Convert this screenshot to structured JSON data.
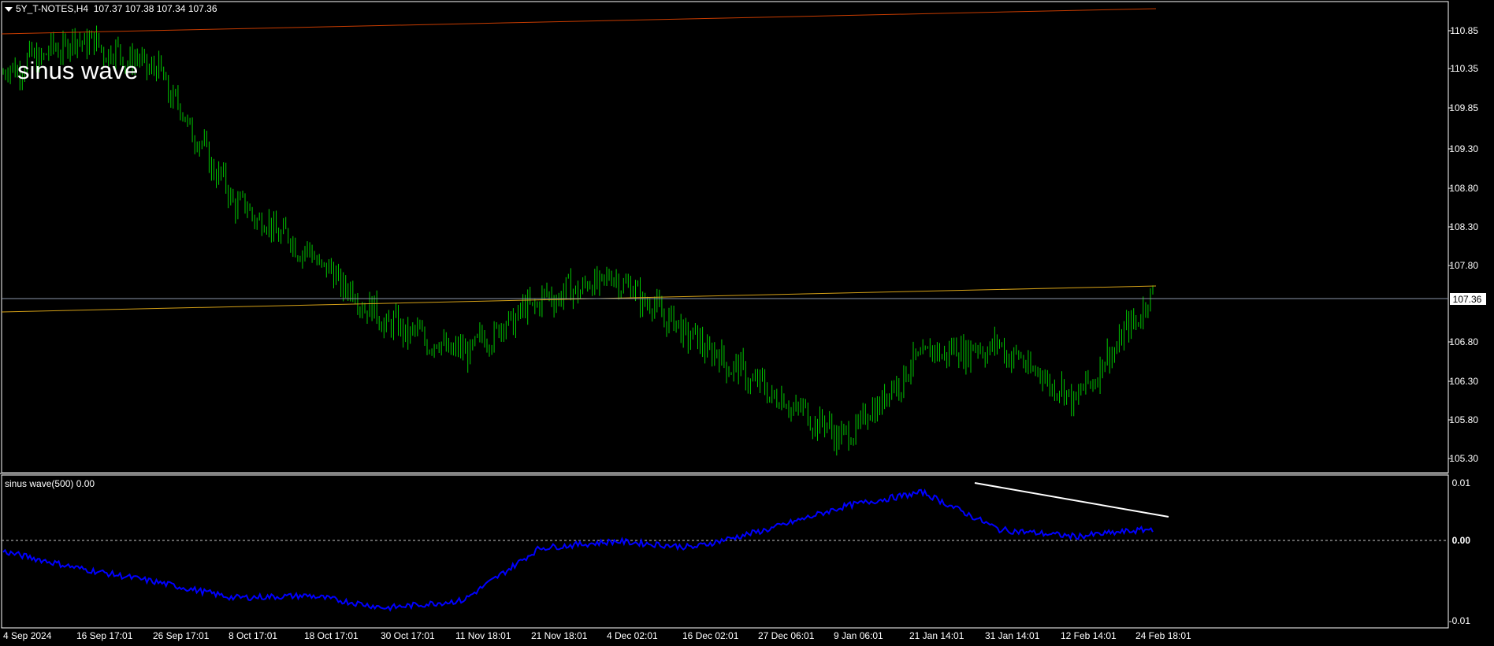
{
  "header": {
    "symbol": "5Y_T-NOTES,H4",
    "ohlc": "107.37 107.38 107.34 107.36"
  },
  "annotation": "sinus wave",
  "indicator": {
    "title": "sinus wave(500) 0.00"
  },
  "price_axis": {
    "labels": [
      "110.85",
      "110.35",
      "109.85",
      "109.30",
      "108.80",
      "108.30",
      "107.80",
      "106.80",
      "106.30",
      "105.80",
      "105.30"
    ],
    "current_price": "107.36"
  },
  "indicator_axis": {
    "labels": [
      "0.01",
      "0.00",
      "-0.01"
    ]
  },
  "time_axis": {
    "labels": [
      "4 Sep 2024",
      "16 Sep 17:01",
      "26 Sep 17:01",
      "8 Oct 17:01",
      "18 Oct 17:01",
      "30 Oct 17:01",
      "11 Nov 18:01",
      "21 Nov 18:01",
      "4 Dec 02:01",
      "16 Dec 02:01",
      "27 Dec 06:01",
      "9 Jan 06:01",
      "21 Jan 14:01",
      "31 Jan 14:01",
      "12 Feb 14:01",
      "24 Feb 18:01"
    ]
  },
  "colors": {
    "bars": "#00c800",
    "indicator_line": "#0000ff",
    "upper_trendline": "#c83c00",
    "middle_trendline": "#d4a017",
    "price_line": "#8c96aa",
    "divergence_line": "#ffffff",
    "zero_line": "#c8c8c8"
  },
  "chart_data": {
    "type": "line",
    "title": "5Y_T-NOTES,H4",
    "price_series": {
      "name": "5Y_T-NOTES",
      "x": [
        "4 Sep 2024",
        "16 Sep 17:01",
        "26 Sep 17:01",
        "8 Oct 17:01",
        "18 Oct 17:01",
        "30 Oct 17:01",
        "11 Nov 18:01",
        "21 Nov 18:01",
        "4 Dec 02:01",
        "16 Dec 02:01",
        "27 Dec 06:01",
        "9 Jan 06:01",
        "21 Jan 14:01",
        "31 Jan 14:01",
        "12 Feb 14:01",
        "24 Feb 18:01"
      ],
      "values": [
        110.25,
        110.7,
        110.3,
        108.6,
        107.9,
        107.0,
        106.6,
        107.3,
        107.6,
        106.8,
        106.1,
        105.5,
        106.6,
        106.7,
        106.0,
        107.36
      ],
      "ylim": [
        105.1,
        111.1
      ]
    },
    "indicator_series": {
      "name": "sinus wave(500)",
      "x": [
        "4 Sep 2024",
        "16 Sep 17:01",
        "26 Sep 17:01",
        "8 Oct 17:01",
        "18 Oct 17:01",
        "30 Oct 17:01",
        "11 Nov 18:01",
        "21 Nov 18:01",
        "4 Dec 02:01",
        "16 Dec 02:01",
        "27 Dec 06:01",
        "9 Jan 06:01",
        "21 Jan 14:01",
        "31 Jan 14:01",
        "12 Feb 14:01",
        "24 Feb 18:01"
      ],
      "values": [
        0.0,
        -0.0025,
        -0.0045,
        -0.0068,
        -0.0065,
        -0.0083,
        -0.0072,
        0.0005,
        0.0015,
        0.0006,
        0.0033,
        0.0067,
        0.0087,
        0.0032,
        0.0022,
        0.0033
      ],
      "ylim": [
        -0.011,
        0.011
      ]
    }
  }
}
